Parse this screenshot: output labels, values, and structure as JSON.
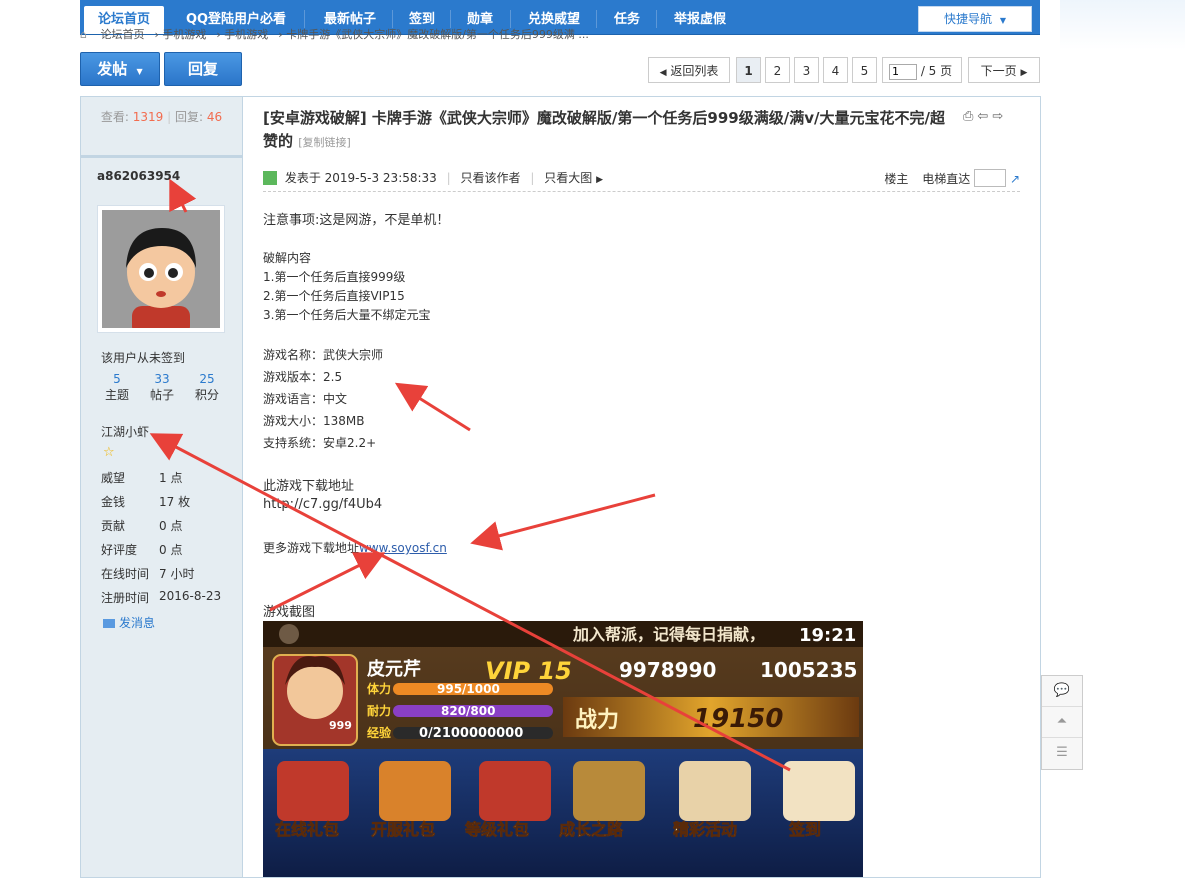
{
  "nav": {
    "items": [
      "论坛首页",
      "QQ登陆用户必看",
      "最新帖子",
      "签到",
      "勋章",
      "兑换威望",
      "任务",
      "举报虚假"
    ],
    "quick_nav": "快捷导航"
  },
  "breadcrumb": [
    "论坛首页",
    "手机游戏",
    "手机游戏",
    "卡牌手游《武侠大宗师》魔改破解版/第一个任务后999级满 ..."
  ],
  "actions": {
    "post": "发帖",
    "reply": "回复"
  },
  "pager": {
    "back": "返回列表",
    "pages": [
      "1",
      "2",
      "3",
      "4",
      "5"
    ],
    "current_input": "1",
    "total": "/ 5 页",
    "next": "下一页"
  },
  "sidebar": {
    "views_label": "查看:",
    "views": "1319",
    "replies_label": "回复:",
    "replies": "46",
    "username": "a862063954",
    "sign_status": "该用户从未签到",
    "stats": [
      {
        "n": "5",
        "l": "主题"
      },
      {
        "n": "33",
        "l": "帖子"
      },
      {
        "n": "25",
        "l": "积分"
      }
    ],
    "rank": "江湖小虾",
    "info": [
      {
        "k": "威望",
        "v": "1 点"
      },
      {
        "k": "金钱",
        "v": "17 枚"
      },
      {
        "k": "贡献",
        "v": "0 点"
      },
      {
        "k": "好评度",
        "v": "0 点"
      },
      {
        "k": "在线时间",
        "v": "7 小时"
      },
      {
        "k": "注册时间",
        "v": "2016-8-23"
      }
    ],
    "pm": "发消息"
  },
  "post": {
    "title": "[安卓游戏破解] 卡牌手游《武侠大宗师》魔改破解版/第一个任务后999级满级/满v/大量元宝花不完/超赞的",
    "copy_link": "[复制链接]",
    "posted": "发表于 2019-5-3 23:58:33",
    "only_author": "只看该作者",
    "only_big": "只看大图",
    "floor": "楼主",
    "elevator": "电梯直达",
    "lines": {
      "notice": "注意事项:这是网游，不是单机！",
      "crack_title": "破解内容",
      "c1": "1.第一个任务后直接999级",
      "c2": "2.第一个任务后直接VIP15",
      "c3": "3.第一个任务后大量不绑定元宝",
      "name": "游戏名称：武侠大宗师",
      "version": "游戏版本：2.5",
      "lang": "游戏语言：中文",
      "size": "游戏大小：138MB",
      "system": "支持系统：安卓2.2+",
      "dl_title": "此游戏下载地址",
      "dl_url": "http://c7.gg/f4Ub4",
      "more_prefix": "更多游戏下载地址",
      "more_link": "www.soyosf.cn",
      "shot_title": "游戏截图"
    }
  },
  "game_shot": {
    "banner": "加入帮派，记得每日捐献，",
    "time": "19:21",
    "player": "皮元芹",
    "vip": "VIP 15",
    "silver": "9978990",
    "gold": "1005235",
    "hp_label": "体力",
    "hp": "995/1000",
    "mp_label": "耐力",
    "mp": "820/800",
    "exp_label": "经验",
    "exp": "0/2100000000",
    "level": "999",
    "power_label": "战力",
    "power": "19150",
    "buttons": [
      "在线礼包",
      "开服礼包",
      "等级礼包",
      "成长之路",
      "精彩活动",
      "签到"
    ]
  },
  "colors": {
    "nav": "#2b7acd",
    "accent": "#f26c4f",
    "arrow": "#e8413a"
  }
}
